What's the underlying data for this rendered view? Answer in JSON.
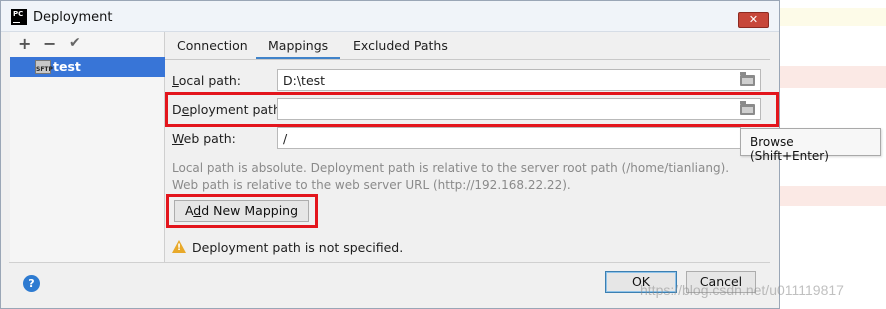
{
  "window": {
    "title": "Deployment",
    "app_icon_text": "PC"
  },
  "left_panel": {
    "toolbar": {
      "add": "+",
      "remove": "−",
      "check": "✔"
    },
    "servers": [
      {
        "label": "test",
        "type_badge": "SFTP",
        "selected": true
      }
    ]
  },
  "tabs": [
    {
      "label": "Connection",
      "active": false
    },
    {
      "label": "Mappings",
      "active": true
    },
    {
      "label": "Excluded Paths",
      "active": false
    }
  ],
  "fields": {
    "local_path": {
      "label_mn": "L",
      "label_rest": "ocal path:",
      "value": "D:\\test"
    },
    "deployment_path": {
      "label_pre": "D",
      "label_mn": "e",
      "label_rest": "ployment path:",
      "value": ""
    },
    "web_path": {
      "label_mn": "W",
      "label_rest": "eb path:",
      "value": "/"
    }
  },
  "tooltip": "Browse (Shift+Enter)",
  "hints": [
    "Local path is absolute. Deployment path is relative to the server root path (/home/tianliang).",
    "Web path is relative to the web server URL (http://192.168.22.22)."
  ],
  "add_mapping_button": {
    "label_pre": "A",
    "label_mn": "d",
    "label_rest": "d New Mapping"
  },
  "warning": "Deployment path is not specified.",
  "footer": {
    "help": "?",
    "ok": "OK",
    "cancel": "Cancel"
  },
  "watermark": "https://blog.csdn.net/u011119817",
  "colors": {
    "accent": "#3875d7",
    "highlight_box": "#e3151c",
    "warning": "#e8a92a",
    "tab_underline": "#4083c9"
  }
}
